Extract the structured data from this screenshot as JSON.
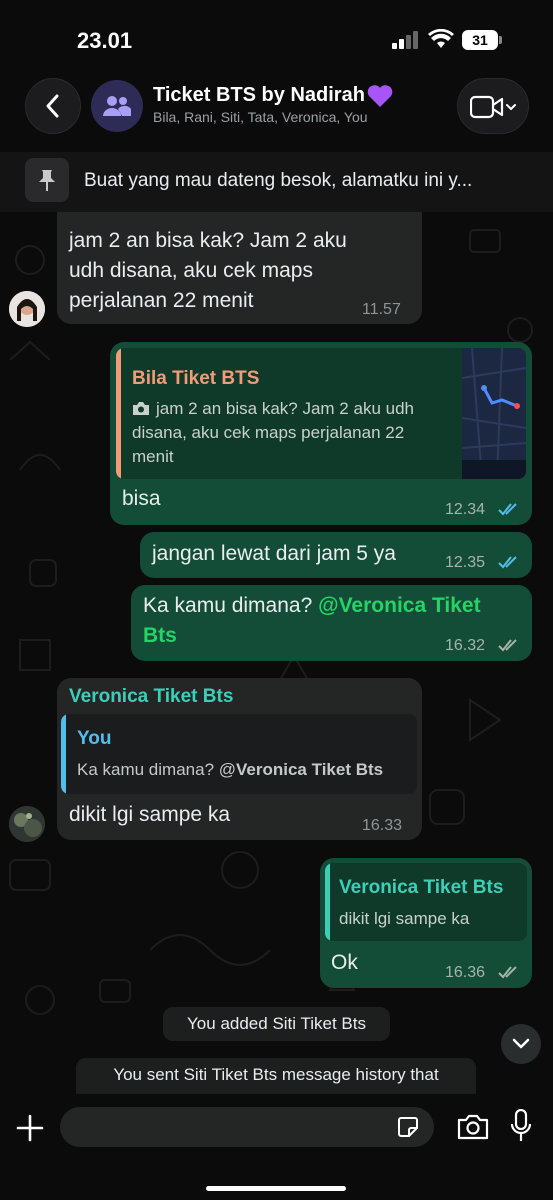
{
  "status_bar": {
    "time": "23.01",
    "battery": "31"
  },
  "header": {
    "group_name": "Ticket BTS by Nadirah",
    "members": "Bila, Rani, Siti, Tata, Veronica, You"
  },
  "pinned": {
    "text": "Buat yang mau dateng besok, alamatku ini y..."
  },
  "colors": {
    "outgoing_bubble": "#144d37",
    "incoming_bubble": "#242626",
    "quote_bila": "#f29b78",
    "quote_you": "#53bdeb",
    "quote_veronica": "#3ccfb8",
    "mention": "#25d366",
    "read_ticks": "#53bdeb"
  },
  "messages": {
    "m1": {
      "lines": [
        "jam 2 an bisa kak? Jam 2 aku",
        "udh disana, aku cek maps",
        "perjalanan 22 menit"
      ],
      "time": "11.57"
    },
    "m2": {
      "quote_name": "Bila Tiket BTS",
      "quote_lines": [
        "jam 2 an bisa kak? Jam 2 aku udh",
        "disana, aku cek maps perjalanan 22",
        "menit"
      ],
      "text": "bisa",
      "time": "12.34",
      "status": "read"
    },
    "m3": {
      "text": "jangan lewat dari jam 5 ya",
      "time": "12.35",
      "status": "read"
    },
    "m4": {
      "text_prefix": "Ka kamu dimana? ",
      "mention": "@Veronica Tiket",
      "mention_line2": "Bts",
      "time": "16.32",
      "status": "delivered"
    },
    "m5": {
      "sender": "Veronica Tiket Bts",
      "quote_name": "You",
      "quote_text_prefix": "Ka kamu dimana? @",
      "quote_text_bold": "Veronica Tiket Bts",
      "text": "dikit lgi sampe ka",
      "time": "16.33"
    },
    "m6": {
      "quote_name": "Veronica Tiket Bts",
      "quote_text": "dikit lgi sampe ka",
      "text": "Ok",
      "time": "16.36",
      "status": "delivered"
    }
  },
  "system": {
    "added": "You added Siti Tiket Bts",
    "history": "You sent Siti Tiket Bts message history that"
  },
  "input": {
    "placeholder": ""
  }
}
